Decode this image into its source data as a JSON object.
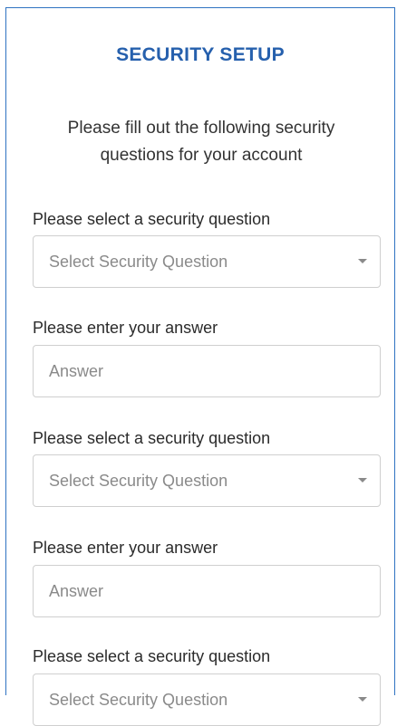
{
  "header": {
    "title": "SECURITY SETUP",
    "subtitle": "Please fill out the following security questions for your account"
  },
  "form": {
    "fields": [
      {
        "label": "Please select a security question",
        "type": "select",
        "placeholder": "Select Security Question"
      },
      {
        "label": "Please enter your answer",
        "type": "input",
        "placeholder": "Answer"
      },
      {
        "label": "Please select a security question",
        "type": "select",
        "placeholder": "Select Security Question"
      },
      {
        "label": "Please enter your answer",
        "type": "input",
        "placeholder": "Answer"
      },
      {
        "label": "Please select a security question",
        "type": "select",
        "placeholder": "Select Security Question"
      }
    ]
  },
  "icons": {
    "dropdown": "chevron-down-icon"
  },
  "colors": {
    "accent": "#2660ad",
    "border": "#2f73c2",
    "placeholder": "#8a8a8a"
  }
}
